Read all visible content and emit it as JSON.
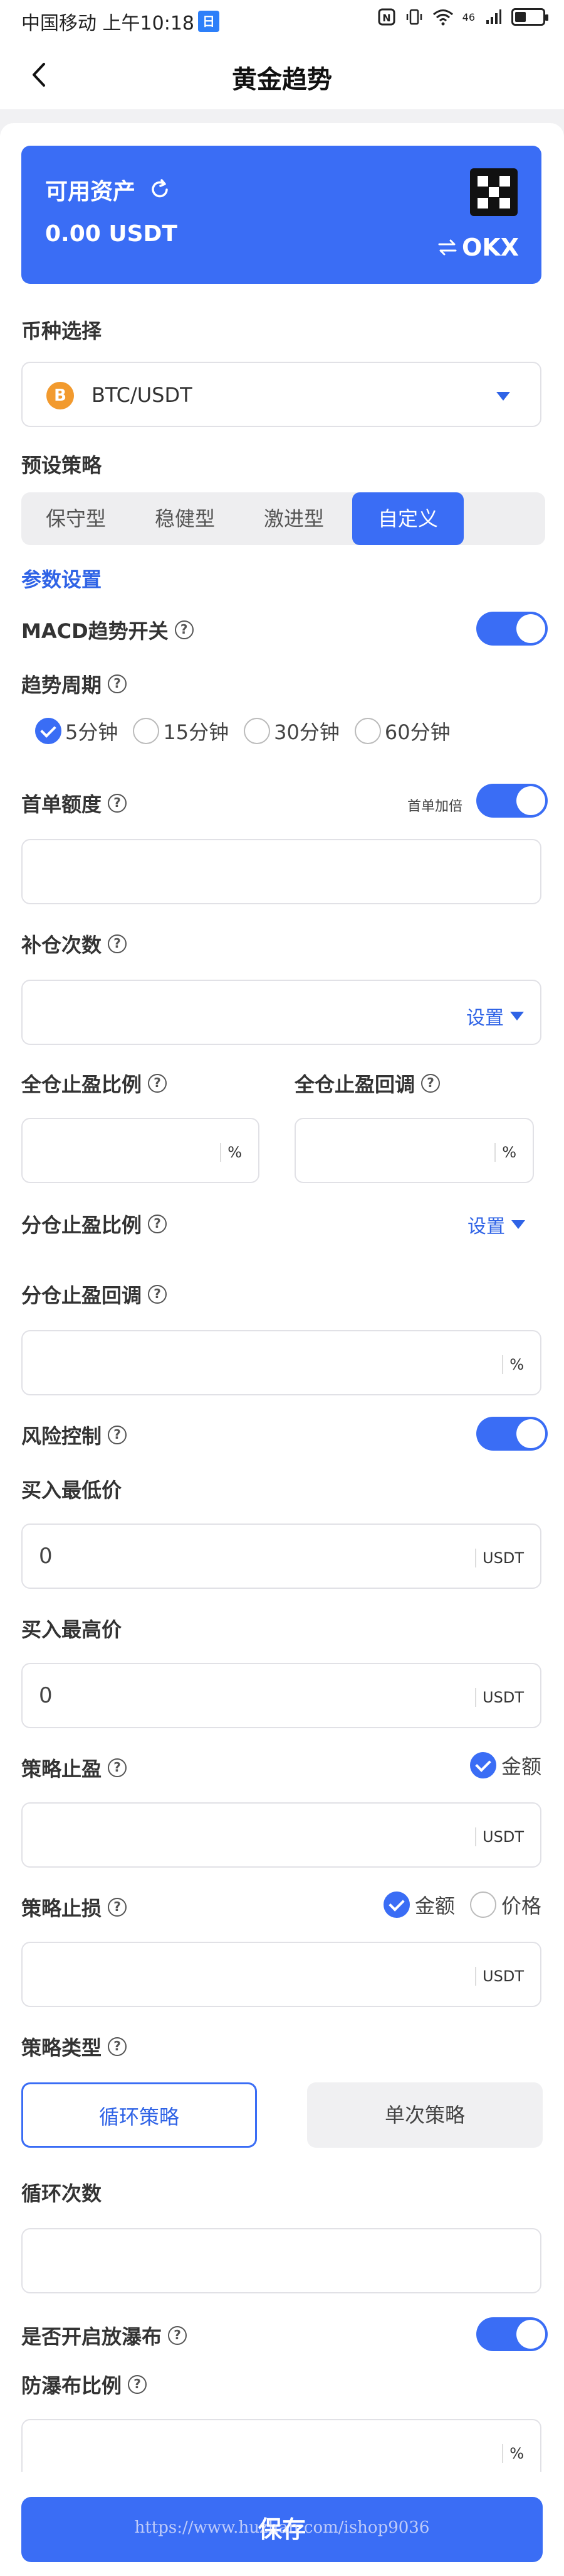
{
  "status": {
    "carrier": "中国移动 上午10:18",
    "app_badge": "日",
    "signal": "46",
    "battery_level": 0.4
  },
  "nav": {
    "title": "黄金趋势"
  },
  "asset": {
    "label": "可用资产",
    "amount": "0.00 USDT",
    "exchange": "OKX"
  },
  "coin": {
    "label": "币种选择",
    "value": "BTC/USDT",
    "icon_glyph": "B",
    "icon_color": "#f29a2e"
  },
  "strategy_presets": {
    "label": "预设策略",
    "tabs": [
      "保守型",
      "稳健型",
      "激进型",
      "自定义"
    ],
    "active_index": 3
  },
  "params": {
    "label": "参数设置"
  },
  "macd": {
    "label": "MACD趋势开关",
    "on": true
  },
  "period": {
    "label": "趋势周期",
    "options": [
      "5分钟",
      "15分钟",
      "30分钟",
      "60分钟"
    ],
    "selected_index": 0
  },
  "first_order": {
    "label": "首单额度",
    "double_label": "首单加倍",
    "double_on": true,
    "value": ""
  },
  "add_count": {
    "label": "补仓次数",
    "setting_label": "设置",
    "value": ""
  },
  "full_tp_ratio": {
    "label": "全仓止盈比例",
    "unit": "%",
    "value": ""
  },
  "full_tp_pullback": {
    "label": "全仓止盈回调",
    "unit": "%",
    "value": ""
  },
  "split_tp_ratio": {
    "label": "分仓止盈比例",
    "setting_label": "设置"
  },
  "split_tp_pullback": {
    "label": "分仓止盈回调",
    "unit": "%",
    "value": ""
  },
  "risk": {
    "label": "风险控制",
    "on": true
  },
  "buy_min": {
    "label": "买入最低价",
    "value": "0",
    "unit": "USDT"
  },
  "buy_max": {
    "label": "买入最高价",
    "value": "0",
    "unit": "USDT"
  },
  "strategy_tp": {
    "label": "策略止盈",
    "mode_label": "金额",
    "mode_checked": true,
    "unit": "USDT",
    "value": ""
  },
  "strategy_sl": {
    "label": "策略止损",
    "mode_amount": "金额",
    "mode_price": "价格",
    "amount_checked": true,
    "unit": "USDT",
    "value": ""
  },
  "strategy_type": {
    "label": "策略类型",
    "options": [
      "循环策略",
      "单次策略"
    ],
    "active_index": 0
  },
  "loop_count": {
    "label": "循环次数",
    "value": ""
  },
  "waterfall": {
    "label": "是否开启放瀑布",
    "on": true
  },
  "anti_waterfall": {
    "label": "防瀑布比例",
    "unit": "%",
    "value": ""
  },
  "save": {
    "label": "保存",
    "watermark": "https://www.huzhan.com/ishop9036"
  },
  "colors": {
    "primary": "#3a6df5",
    "link": "#2f63e6"
  }
}
